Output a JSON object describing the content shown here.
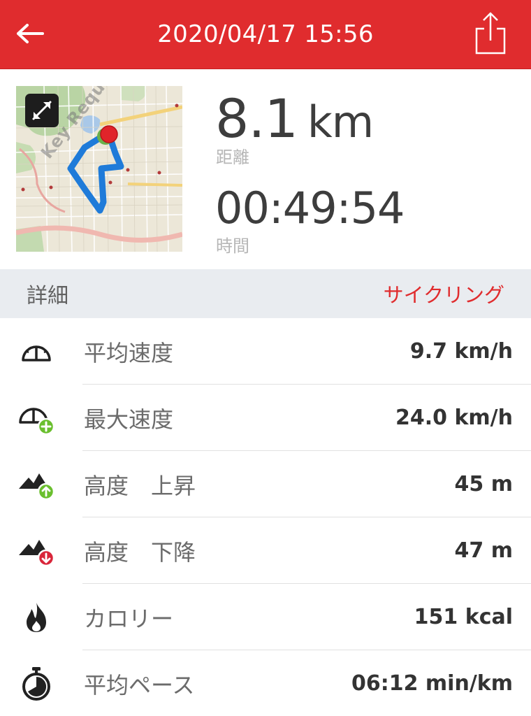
{
  "header": {
    "title": "2020/04/17 15:56",
    "back_icon": "arrow-left-icon",
    "share_icon": "share-icon",
    "background_color": "#e02c2e"
  },
  "summary": {
    "map_watermark": "Key Required",
    "expand_icon": "expand-icon",
    "route_color": "#1f7bd9",
    "marker_color": "#e0242a",
    "distance_value": "8.1",
    "distance_unit": "km",
    "distance_label": "距離",
    "duration_value": "00:49:54",
    "duration_label": "時間"
  },
  "details": {
    "section_title": "詳細",
    "activity_type": "サイクリング",
    "accent_color": "#e02c2e",
    "metrics": [
      {
        "icon": "speedometer-icon",
        "label": "平均速度",
        "value": "9.7 km/h"
      },
      {
        "icon": "speedometer-plus-icon",
        "label": "最大速度",
        "value": "24.0 km/h"
      },
      {
        "icon": "mountain-up-icon",
        "label": "高度　上昇",
        "value": "45 m"
      },
      {
        "icon": "mountain-down-icon",
        "label": "高度　下降",
        "value": "47 m"
      },
      {
        "icon": "flame-icon",
        "label": "カロリー",
        "value": "151 kcal"
      },
      {
        "icon": "stopwatch-icon",
        "label": "平均ペース",
        "value": "06:12 min/km"
      }
    ]
  }
}
